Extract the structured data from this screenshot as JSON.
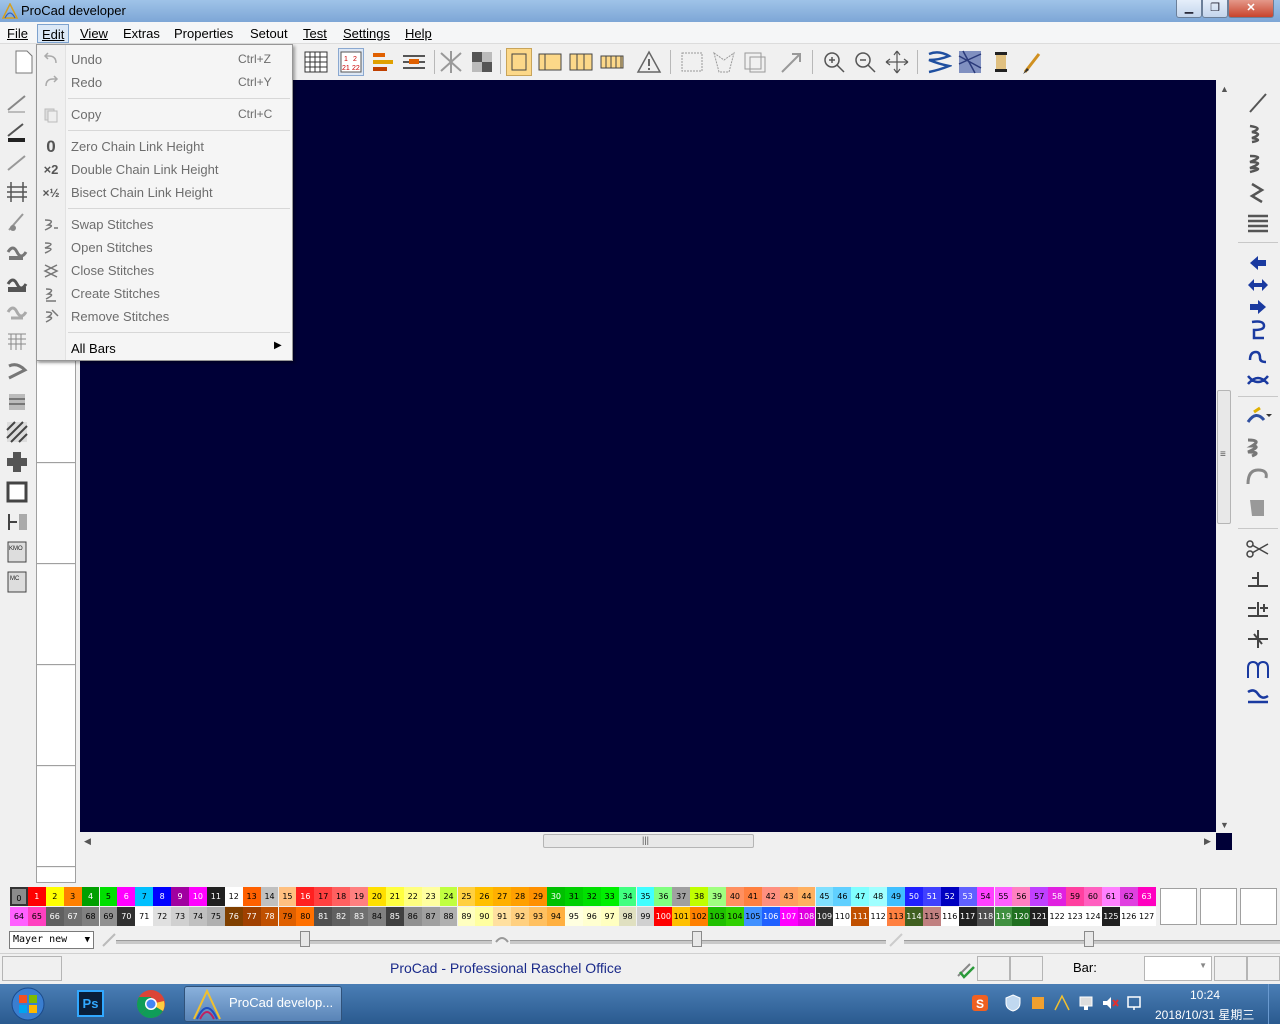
{
  "window": {
    "title": "ProCad developer",
    "buttons": {
      "minimize": "▁",
      "maximize": "❐",
      "close": "✕"
    }
  },
  "menubar": {
    "items": [
      {
        "label": "File"
      },
      {
        "label": "Edit"
      },
      {
        "label": "View"
      },
      {
        "label": "Extras"
      },
      {
        "label": "Properties"
      },
      {
        "label": "Setout"
      },
      {
        "label": "Test"
      },
      {
        "label": "Settings"
      },
      {
        "label": "Help"
      }
    ]
  },
  "toolbar": {
    "numbers_icon": [
      "1",
      "2",
      "21",
      "22"
    ]
  },
  "edit_menu": {
    "undo": {
      "label": "Undo",
      "shortcut": "Ctrl+Z"
    },
    "redo": {
      "label": "Redo",
      "shortcut": "Ctrl+Y"
    },
    "copy": {
      "label": "Copy",
      "shortcut": "Ctrl+C"
    },
    "zero_chain": {
      "label": "Zero Chain Link Height",
      "icon": "0"
    },
    "double_chain": {
      "label": "Double Chain Link Height",
      "icon": "×2"
    },
    "bisect_chain": {
      "label": "Bisect Chain Link Height",
      "icon": "×½"
    },
    "swap": {
      "label": "Swap Stitches"
    },
    "open": {
      "label": "Open Stitches"
    },
    "close": {
      "label": "Close Stitches"
    },
    "create": {
      "label": "Create Stitches"
    },
    "remove": {
      "label": "Remove Stitches"
    },
    "all_bars": {
      "label": "All Bars",
      "arrow": "▶"
    }
  },
  "scrollbar": {
    "up": "▲",
    "down": "▼",
    "left": "◀",
    "right": "▶",
    "grip": "|||",
    "vgrip": "≡"
  },
  "palette": {
    "row1": [
      "0",
      "1",
      "2",
      "3",
      "4",
      "5",
      "6",
      "7",
      "8",
      "9",
      "10",
      "11",
      "12",
      "13",
      "14",
      "15",
      "16",
      "17",
      "18",
      "19",
      "20",
      "21",
      "22",
      "23",
      "24",
      "25",
      "26",
      "27",
      "28",
      "29",
      "30",
      "31",
      "32",
      "33",
      "34",
      "35",
      "36",
      "37",
      "38",
      "39",
      "40",
      "41",
      "42",
      "43",
      "44",
      "45",
      "46",
      "47",
      "48",
      "49",
      "50",
      "51",
      "52",
      "53",
      "54",
      "55",
      "56",
      "57",
      "58",
      "59",
      "60",
      "61",
      "62",
      "63"
    ],
    "row2": [
      "64",
      "65",
      "66",
      "67",
      "68",
      "69",
      "70",
      "71",
      "72",
      "73",
      "74",
      "75",
      "76",
      "77",
      "78",
      "79",
      "80",
      "81",
      "82",
      "83",
      "84",
      "85",
      "86",
      "87",
      "88",
      "89",
      "90",
      "91",
      "92",
      "93",
      "94",
      "95",
      "96",
      "97",
      "98",
      "99",
      "100",
      "101",
      "102",
      "103",
      "104",
      "105",
      "106",
      "107",
      "108",
      "109",
      "110",
      "111",
      "112",
      "113",
      "114",
      "115",
      "116",
      "117",
      "118",
      "119",
      "120",
      "121",
      "122",
      "123",
      "124",
      "125",
      "126",
      "127"
    ],
    "colors1": [
      "#8c8c8c",
      "#ff0000",
      "#ffff00",
      "#ff8000",
      "#00a000",
      "#00e000",
      "#ff00ff",
      "#00c0ff",
      "#0000ff",
      "#a000a0",
      "#ff00ff",
      "#202020",
      "#ffffff",
      "#ff6000",
      "#c0c0c0",
      "#ffc080",
      "#ff2020",
      "#ff4040",
      "#ff6060",
      "#ff8080",
      "#ffe000",
      "#ffff40",
      "#ffff80",
      "#ffffa0",
      "#c0ff40",
      "#ffd040",
      "#ffc000",
      "#ffb000",
      "#ffa000",
      "#ff9000",
      "#00c000",
      "#00d000",
      "#00e000",
      "#00f000",
      "#40ff80",
      "#40ffff",
      "#80ff80",
      "#a0a0a0",
      "#c0ff00",
      "#a0ff80",
      "#ff9060",
      "#ff8040",
      "#ff9080",
      "#ffa060",
      "#ffb060",
      "#80e0ff",
      "#60d0ff",
      "#80ffff",
      "#a0ffff",
      "#40c0ff",
      "#2020ff",
      "#4040ff",
      "#0000c0",
      "#6060ff",
      "#ff40ff",
      "#ff60ff",
      "#ff80c0",
      "#c040ff",
      "#e020e0",
      "#ff40a0",
      "#ff60c0",
      "#ff80ff",
      "#e040e0",
      "#ff00c0"
    ],
    "colors2": [
      "#ff60ff",
      "#ff40c0",
      "#606060",
      "#707070",
      "#808080",
      "#909090",
      "#303030",
      "#ffffff",
      "#e0e0e0",
      "#d0d0d0",
      "#c0c0c0",
      "#b0b0b0",
      "#804000",
      "#a04000",
      "#c05000",
      "#e06000",
      "#ff7000",
      "#505050",
      "#606060",
      "#707070",
      "#808080",
      "#404040",
      "#909090",
      "#a0a0a0",
      "#b0b0b0",
      "#ffffc0",
      "#ffffa0",
      "#ffe0a0",
      "#ffd080",
      "#ffc060",
      "#ffb040",
      "#ffffe0",
      "#ffffd0",
      "#ffffc0",
      "#e0e0c0",
      "#d0d0d0",
      "#ff0000",
      "#ffc000",
      "#ff8000",
      "#20c000",
      "#30d000",
      "#4090ff",
      "#2060ff",
      "#ff00ff",
      "#e000e0",
      "#303030",
      "#ffffff",
      "#c05000",
      "#ffffff",
      "#ff8040",
      "#406020",
      "#c08080",
      "#ffffff",
      "#202020",
      "#505050",
      "#409040",
      "#207020",
      "#202020",
      "#ffffff",
      "#ffffff",
      "#ffffff",
      "#202020",
      "#ffffff",
      "#ffffff"
    ]
  },
  "layer": {
    "selected": "Mayer new"
  },
  "status": {
    "text": "ProCad - Professional Raschel Office",
    "bar_label": "Bar:"
  },
  "taskbar": {
    "procad_label": "ProCad develop...",
    "ps_label": "Ps",
    "time": "10:24",
    "date": "2018/10/31 星期三"
  },
  "colors": {
    "canvas": "#000037",
    "accent_blue": "#1a2a8a",
    "menu_highlight": "#dbe8f7"
  }
}
